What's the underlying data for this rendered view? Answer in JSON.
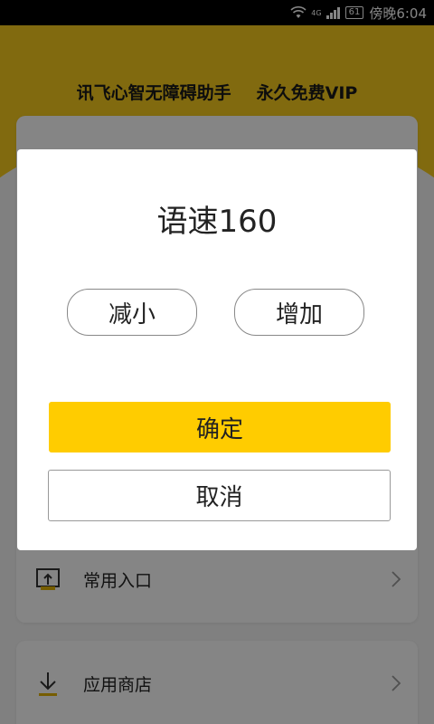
{
  "status_bar": {
    "network": "4G",
    "battery": "61",
    "time": "傍晚6:04"
  },
  "header": {
    "app_name": "讯飞心智无障碍助手",
    "promo": "永久免费VIP"
  },
  "menu": {
    "items": [
      {
        "label": "常用入口",
        "icon": "entry-icon"
      },
      {
        "label": "应用商店",
        "icon": "download-icon"
      }
    ]
  },
  "dialog": {
    "title": "语速160",
    "decrease_label": "减小",
    "increase_label": "增加",
    "confirm_label": "确定",
    "cancel_label": "取消"
  },
  "colors": {
    "accent": "#ffcc00",
    "header_yellow": "#f7cc1e",
    "overlay": "rgba(0,0,0,0.48)"
  }
}
